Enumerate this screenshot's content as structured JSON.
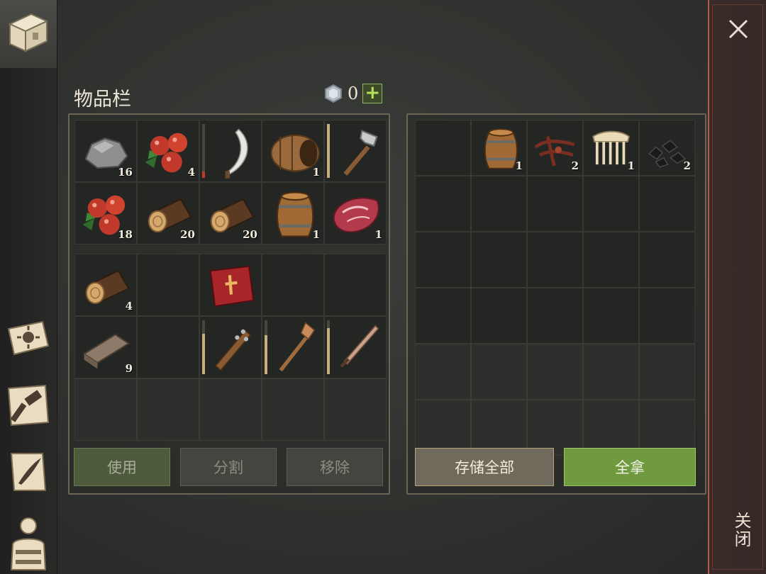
{
  "inventory": {
    "title": "物品栏",
    "currency_value": "0",
    "plus_label": "+"
  },
  "left_grid_top": [
    {
      "item": "stone-icon",
      "count": "16"
    },
    {
      "item": "berries-icon",
      "count": "4"
    },
    {
      "item": "sickle-icon",
      "count": "",
      "durability": 0.12
    },
    {
      "item": "open-barrel-icon",
      "count": "1"
    },
    {
      "item": "stone-hammer-icon",
      "count": "",
      "durability": 1.0
    },
    {
      "item": "berries-icon",
      "count": "18"
    },
    {
      "item": "log-icon",
      "count": "20"
    },
    {
      "item": "log-icon",
      "count": "20"
    },
    {
      "item": "barrel-icon",
      "count": "1"
    },
    {
      "item": "raw-meat-icon",
      "count": "1"
    }
  ],
  "left_grid_bottom": [
    {
      "item": "log-icon",
      "count": "4"
    },
    {
      "item": "",
      "count": ""
    },
    {
      "item": "book-icon",
      "count": ""
    },
    {
      "item": "",
      "count": ""
    },
    {
      "item": "",
      "count": ""
    },
    {
      "item": "wood-plank-icon",
      "count": "9"
    },
    {
      "item": "",
      "count": ""
    },
    {
      "item": "spiked-club-icon",
      "count": "",
      "durability": 0.75
    },
    {
      "item": "shovel-icon",
      "count": "",
      "durability": 0.72
    },
    {
      "item": "sword-icon",
      "count": "",
      "durability": 0.85
    }
  ],
  "right_grid": [
    {
      "item": "",
      "count": ""
    },
    {
      "item": "barrel-icon",
      "count": "1"
    },
    {
      "item": "roots-icon",
      "count": "2"
    },
    {
      "item": "comb-icon",
      "count": "1"
    },
    {
      "item": "coal-icon",
      "count": "2"
    }
  ],
  "buttons": {
    "use": "使用",
    "split": "分割",
    "remove": "移除",
    "store_all": "存储全部",
    "take_all": "全拿"
  },
  "close": {
    "label": "关闭"
  }
}
